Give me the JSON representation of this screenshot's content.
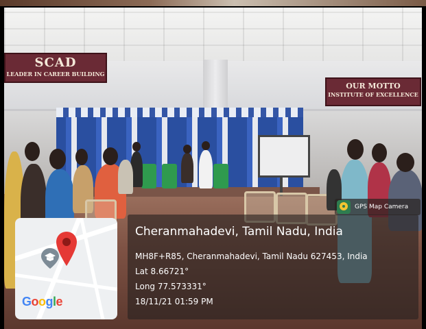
{
  "signs": {
    "left_line1": "SCAD",
    "left_line2": "LEADER IN CAREER BUILDING",
    "right_line1": "OUR MOTTO",
    "right_line2": "INSTITUTE OF EXCELLENCE"
  },
  "gps_badge": {
    "label": "GPS Map Camera",
    "icon": "gps-map-camera-icon"
  },
  "map_card": {
    "brand": [
      "G",
      "o",
      "o",
      "g",
      "l",
      "e"
    ],
    "brand_colors": [
      "#4285F4",
      "#EA4335",
      "#FBBC05",
      "#4285F4",
      "#34A853",
      "#EA4335"
    ],
    "pin_color": "#E53935",
    "pin_icon": "location-pin-icon",
    "marker_icon": "graduation-cap-marker-icon"
  },
  "location": {
    "title": "Cheranmahadevi, Tamil Nadu, India",
    "address": "MH8F+R85, Cheranmahadevi, Tamil Nadu 627453, India",
    "lat": "Lat 8.66721°",
    "long": "Long 77.573331°",
    "datetime": "18/11/21 01:59 PM"
  }
}
